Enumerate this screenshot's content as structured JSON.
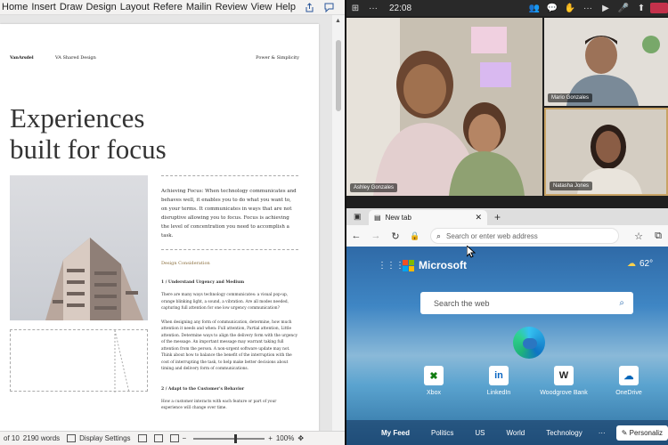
{
  "word": {
    "ribbon_tabs": [
      "Home",
      "Insert",
      "Draw",
      "Design",
      "Layout",
      "Refere",
      "Mailin",
      "Review",
      "View",
      "Help"
    ],
    "document": {
      "brand": "VanArsdel",
      "shared_design": "VA Shared Design",
      "header_right": "Power & Simplicity",
      "title_line1": "Experiences",
      "title_line2": "built for focus",
      "intro": "Achieving Focus: When technology communicates and behaves well, it enables you to do what you want to, on your terms. It communicates in ways that are not disruptive allowing you to focus. Focus is achieving the level of concentration you need to accomplish a task.",
      "section_heading": "Design Consideration",
      "sub1": "1 / Understand Urgency and Medium",
      "para1": "There are many ways technology communicates: a visual pop-up, orange blinking light, a sound, a vibration. Are all modes needed, capturing full attention for one low urgency communication?",
      "para2": "When designing any form of communication, determine, how much attention it needs and when: Full attention, Partial attention, Little attention. Determine ways to align the delivery form with the urgency of the message. An important message may warrant taking full attention from the person. A non-urgent software update may not. Think about how to balance the benefit of the interruption with the cost of interrupting the task, to help make better decisions about timing and delivery form of communications.",
      "sub2": "2 / Adapt to the Customer's Behavior",
      "para3": "How a customer interacts with each feature or part of your experience will change over time."
    },
    "status": {
      "pages": "of 10",
      "words": "2190 words",
      "display_settings": "Display Settings",
      "zoom": "100%"
    }
  },
  "teams": {
    "clock": "22:08",
    "participants": {
      "main": "Ashley Gonzales",
      "top_right": "Mario Gonzales",
      "bottom_right": "Natasha Jones"
    }
  },
  "edge": {
    "tab_title": "New tab",
    "address_placeholder": "Search or enter web address",
    "brand": "Microsoft",
    "weather": "62°",
    "search_placeholder": "Search the web",
    "quick_links": [
      "Xbox",
      "LinkedIn",
      "Woodgrove Bank",
      "OneDrive"
    ],
    "feed_tabs": [
      "My Feed",
      "Politics",
      "US",
      "World",
      "Technology"
    ],
    "more": "···",
    "personalize": "Personaliz"
  },
  "colors": {
    "word_blue": "#2b579a",
    "leave_red": "#c4314b",
    "active_speaker": "#c8a365",
    "ms_red": "#f25022",
    "ms_green": "#7fba00",
    "ms_blue": "#00a4ef",
    "ms_yellow": "#ffb900"
  }
}
